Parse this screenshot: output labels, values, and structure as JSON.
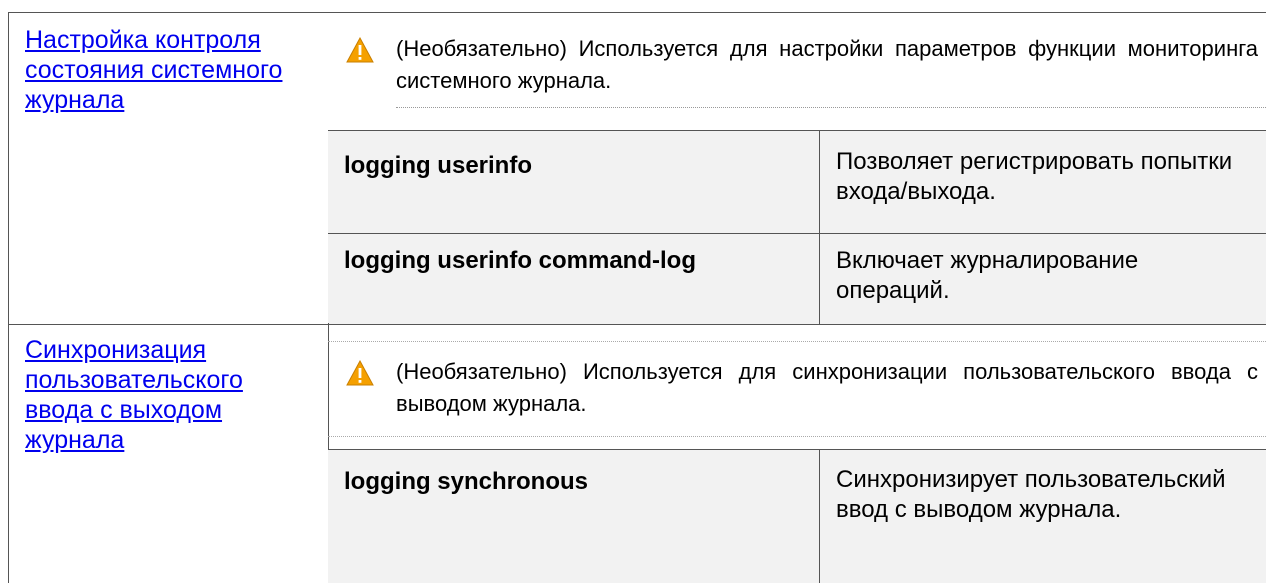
{
  "rows": [
    {
      "link": "Настройка контроля состояния системного журнала",
      "note": "(Необязательно) Используется для настройки параметров функции мониторинга системного журнала.",
      "commands": [
        {
          "cmd": "logging userinfo",
          "desc": "Позволяет регистрировать попытки входа/выхода."
        },
        {
          "cmd": "logging userinfo command-log",
          "desc": "Включает журналирование операций."
        }
      ]
    },
    {
      "link": "Синхронизация пользовательского ввода с выходом журнала",
      "note": "(Необязательно) Используется для синхронизации пользовательского ввода с выводом журнала.",
      "commands": [
        {
          "cmd": "logging synchronous",
          "desc": "Синхронизирует пользовательский ввод с выводом журнала."
        }
      ]
    }
  ],
  "icons": {
    "warning": "warning-icon",
    "warning_color": "#f5a000"
  }
}
